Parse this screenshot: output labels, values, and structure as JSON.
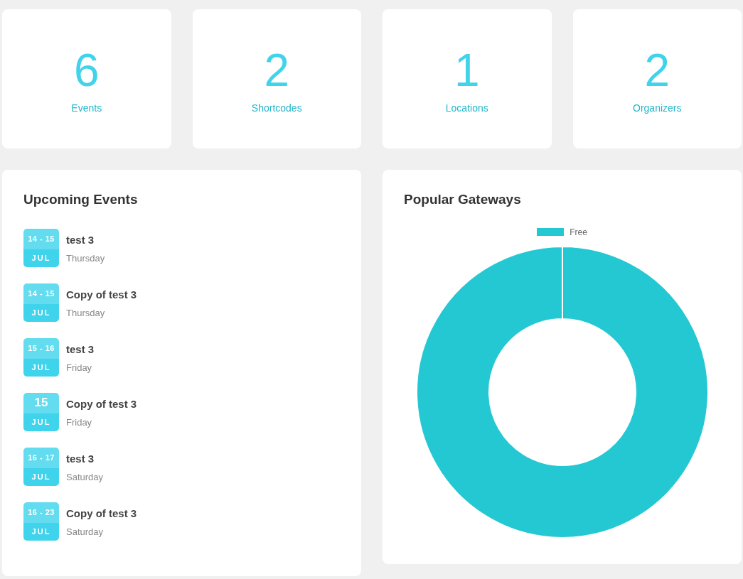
{
  "stats": [
    {
      "value": "6",
      "label": "Events"
    },
    {
      "value": "2",
      "label": "Shortcodes"
    },
    {
      "value": "1",
      "label": "Locations"
    },
    {
      "value": "2",
      "label": "Organizers"
    }
  ],
  "upcoming_events": {
    "title": "Upcoming Events",
    "items": [
      {
        "date": "14 - 15",
        "kind": "range",
        "month": "JUL",
        "name": "test 3",
        "weekday": "Thursday"
      },
      {
        "date": "14 - 15",
        "kind": "range",
        "month": "JUL",
        "name": "Copy of test 3",
        "weekday": "Thursday"
      },
      {
        "date": "15 - 16",
        "kind": "range",
        "month": "JUL",
        "name": "test 3",
        "weekday": "Friday"
      },
      {
        "date": "15",
        "kind": "single",
        "month": "JUL",
        "name": "Copy of test 3",
        "weekday": "Friday"
      },
      {
        "date": "16 - 17",
        "kind": "range",
        "month": "JUL",
        "name": "test 3",
        "weekday": "Saturday"
      },
      {
        "date": "16 - 23",
        "kind": "range",
        "month": "JUL",
        "name": "Copy of test 3",
        "weekday": "Saturday"
      }
    ]
  },
  "popular_gateways": {
    "title": "Popular Gateways",
    "legend": [
      {
        "label": "Free",
        "color": "#24c8d3"
      }
    ]
  }
}
